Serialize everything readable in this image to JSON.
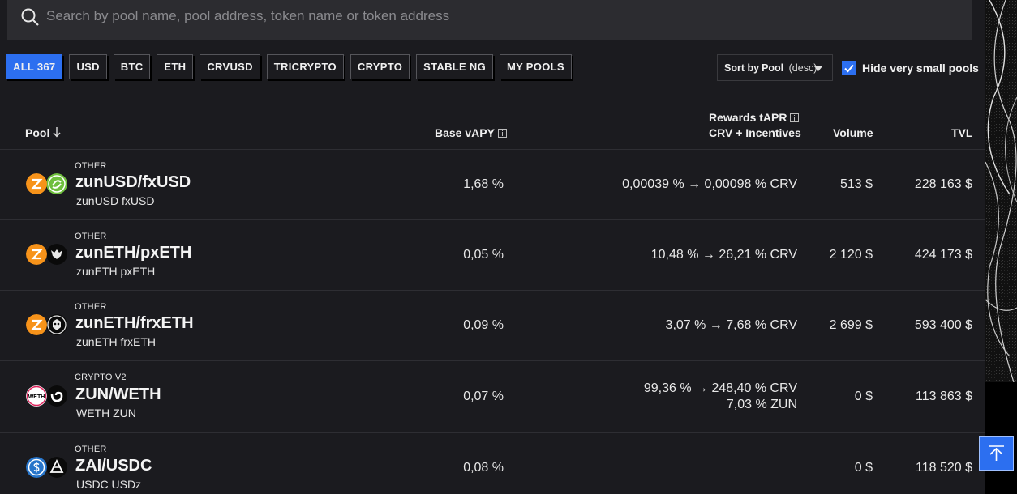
{
  "search": {
    "placeholder": "Search by pool name, pool address, token name or token address"
  },
  "filters": [
    {
      "label": "ALL 367",
      "active": true
    },
    {
      "label": "USD"
    },
    {
      "label": "BTC"
    },
    {
      "label": "ETH"
    },
    {
      "label": "CRVUSD"
    },
    {
      "label": "TRICRYPTO"
    },
    {
      "label": "CRYPTO"
    },
    {
      "label": "STABLE NG"
    },
    {
      "label": "MY POOLS"
    }
  ],
  "sort": {
    "prefix": "Sort by",
    "field": "Pool",
    "direction": "(desc)"
  },
  "hide_small": {
    "label": "Hide very small pools",
    "checked": true
  },
  "columns": {
    "pool": "Pool",
    "base_vapy": "Base vAPY",
    "rewards_line1": "Rewards tAPR",
    "rewards_line2": "CRV + Incentives",
    "volume": "Volume",
    "tvl": "TVL"
  },
  "rows": [
    {
      "type": "OTHER",
      "name": "zunUSD/fxUSD",
      "tokens": "zunUSD fxUSD",
      "base_vapy": "1,68 %",
      "rewards": [
        "0,00039 % → 0,00098 % CRV"
      ],
      "volume": "513 $",
      "tvl": "228 163 $"
    },
    {
      "type": "OTHER",
      "name": "zunETH/pxETH",
      "tokens": "zunETH pxETH",
      "base_vapy": "0,05 %",
      "rewards": [
        "10,48 % → 26,21 % CRV"
      ],
      "volume": "2 120 $",
      "tvl": "424 173 $"
    },
    {
      "type": "OTHER",
      "name": "zunETH/frxETH",
      "tokens": "zunETH frxETH",
      "base_vapy": "0,09 %",
      "rewards": [
        "3,07 % → 7,68 % CRV"
      ],
      "volume": "2 699 $",
      "tvl": "593 400 $"
    },
    {
      "type": "CRYPTO V2",
      "name": "ZUN/WETH",
      "tokens": "WETH ZUN",
      "base_vapy": "0,07 %",
      "rewards": [
        "99,36 % → 248,40 % CRV",
        "7,03 % ZUN"
      ],
      "volume": "0 $",
      "tvl": "113 863 $"
    },
    {
      "type": "OTHER",
      "name": "ZAI/USDC",
      "tokens": "USDC USDz",
      "base_vapy": "0,08 %",
      "rewards": [],
      "volume": "0 $",
      "tvl": "118 520 $"
    }
  ],
  "coin_icons": [
    "zun-token-icon",
    "fxusd-token-icon",
    "pxeth-token-icon",
    "frxeth-token-icon",
    "weth-token-icon",
    "zun-swirl-token-icon",
    "usdc-token-icon",
    "usdz-token-icon"
  ],
  "weth_icon_text": "WETH",
  "colors": {
    "accent": "#2c6ff0",
    "background": "#1b1b1f",
    "search_bg": "#2c2c30",
    "zun_orange": "#f7931a"
  }
}
